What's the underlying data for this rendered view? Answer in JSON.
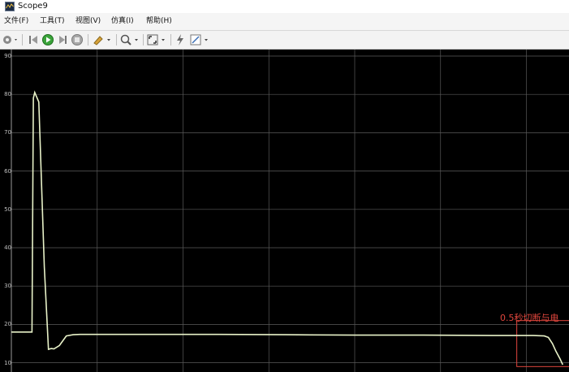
{
  "window": {
    "title": "Scope9"
  },
  "menu": [
    {
      "label": "文件(F)"
    },
    {
      "label": "工具(T)"
    },
    {
      "label": "视图(V)"
    },
    {
      "label": "仿真(I)"
    },
    {
      "label": "帮助(H)"
    }
  ],
  "toolbar": {
    "icons": [
      "settings-icon",
      "step-back-icon",
      "run-icon",
      "step-forward-icon",
      "stop-icon",
      "highlight-icon",
      "zoom-icon",
      "fit-icon",
      "cursor-measure-icon",
      "style-icon"
    ]
  },
  "colors": {
    "plot_bg": "#000000",
    "grid": "#5a5a5a",
    "signal": "#e8f2c8",
    "annotation": "#e0463d"
  },
  "chart_data": {
    "type": "line",
    "ylim": [
      10,
      90
    ],
    "yticks": [
      {
        "value": 90,
        "label": "90"
      },
      {
        "value": 80,
        "label": "80"
      },
      {
        "value": 70,
        "label": "70"
      },
      {
        "value": 60,
        "label": "60"
      },
      {
        "value": 50,
        "label": "50"
      },
      {
        "value": 40,
        "label": "40"
      },
      {
        "value": 30,
        "label": "30"
      },
      {
        "value": 20,
        "label": "20"
      },
      {
        "value": 10,
        "label": "10"
      }
    ],
    "xlim": [
      0,
      1
    ],
    "grid": true,
    "series": [
      {
        "x": [
          0.0,
          0.002,
          0.003,
          0.03,
          0.032,
          0.034,
          0.04,
          0.048,
          0.054,
          0.058,
          0.062,
          0.07,
          0.08,
          0.09,
          0.1,
          0.2,
          0.3,
          0.4,
          0.5,
          0.6,
          0.7,
          0.76,
          0.776,
          0.782,
          0.788,
          0.793,
          0.799,
          0.803
        ],
        "y": [
          18.0,
          18.0,
          18.0,
          18.0,
          79.0,
          80.5,
          78.0,
          35.0,
          13.5,
          13.7,
          13.6,
          14.5,
          17.0,
          17.3,
          17.4,
          17.4,
          17.4,
          17.3,
          17.2,
          17.2,
          17.1,
          17.1,
          17.0,
          16.6,
          15.0,
          13.0,
          11.0,
          9.5
        ]
      }
    ],
    "annotations": [
      {
        "text": "0.5秒切断与电",
        "x_range": [
          0.736,
          0.848
        ],
        "y_range": [
          9.0,
          21.0
        ]
      }
    ]
  }
}
